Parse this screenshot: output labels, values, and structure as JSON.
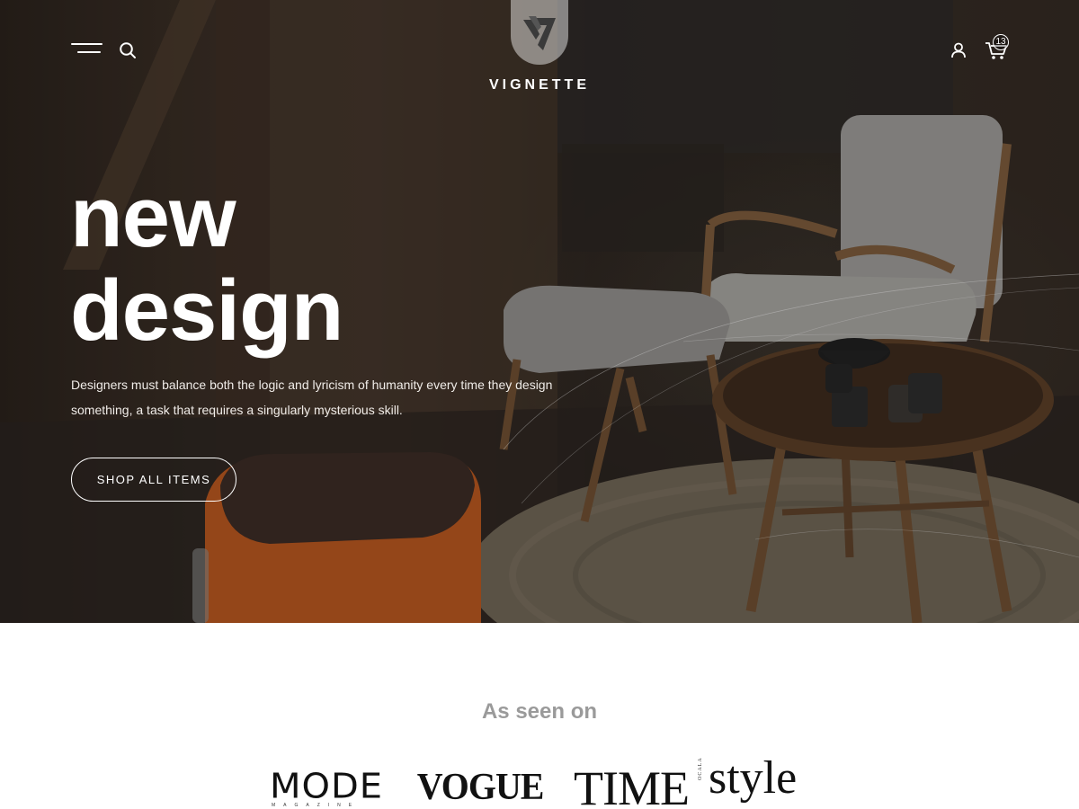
{
  "header": {
    "menu_icon": "hamburger-menu-icon",
    "search_icon": "search-icon",
    "logo_text": "VIGNETTE",
    "account_icon": "user-icon",
    "cart_icon": "cart-icon",
    "cart_count": "13"
  },
  "hero": {
    "title_line1": "new",
    "title_line2": "design",
    "description": "Designers must balance both the logic and lyricism of humanity every time they design something, a task that requires a singularly mysterious skill.",
    "cta_label": "SHOP ALL ITEMS"
  },
  "press": {
    "title": "As seen on",
    "brands": [
      "MODE",
      "VOGUE",
      "TIME",
      "style"
    ],
    "mode_sub": "MAGAZINE",
    "style_sub": "OCALA"
  },
  "colors": {
    "hero_overlay": "#2e2620",
    "text_light": "#ffffff",
    "muted_heading": "#9a9a9a",
    "chair_fabric": "#8f8d8a",
    "ottoman_orange": "#b5561f"
  }
}
